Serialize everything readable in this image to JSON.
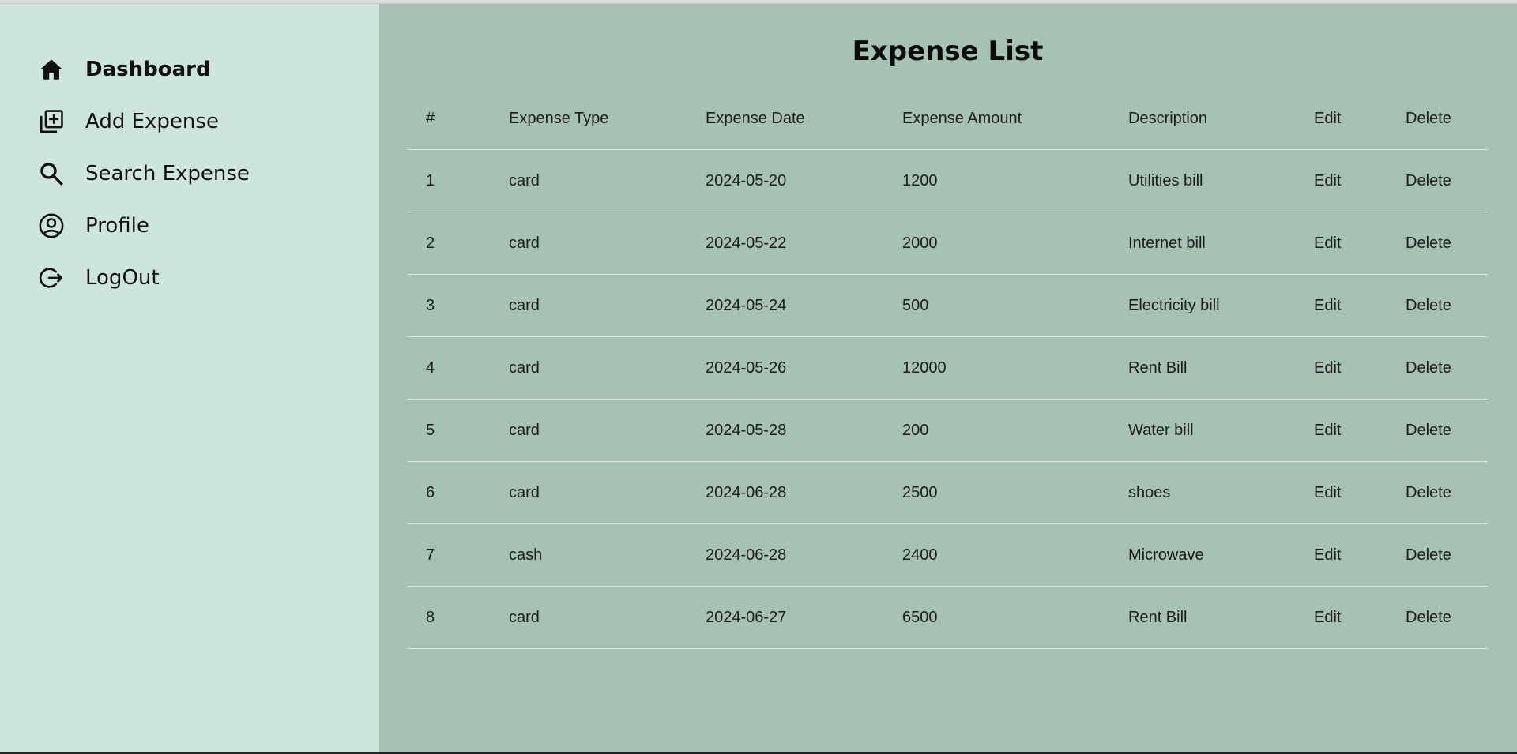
{
  "sidebar": {
    "items": [
      {
        "label": "Dashboard",
        "icon": "home-icon",
        "active": true
      },
      {
        "label": "Add Expense",
        "icon": "add-box-icon",
        "active": false
      },
      {
        "label": "Search Expense",
        "icon": "search-icon",
        "active": false
      },
      {
        "label": "Profile",
        "icon": "user-circle-icon",
        "active": false
      },
      {
        "label": "LogOut",
        "icon": "logout-icon",
        "active": false
      }
    ]
  },
  "main": {
    "title": "Expense List",
    "table": {
      "headers": [
        "#",
        "Expense Type",
        "Expense Date",
        "Expense Amount",
        "Description",
        "Edit",
        "Delete"
      ],
      "rows": [
        [
          "1",
          "card",
          "2024-05-20",
          "1200",
          "Utilities bill",
          "Edit",
          "Delete"
        ],
        [
          "2",
          "card",
          "2024-05-22",
          "2000",
          "Internet bill",
          "Edit",
          "Delete"
        ],
        [
          "3",
          "card",
          "2024-05-24",
          "500",
          "Electricity bill",
          "Edit",
          "Delete"
        ],
        [
          "4",
          "card",
          "2024-05-26",
          "12000",
          "Rent Bill",
          "Edit",
          "Delete"
        ],
        [
          "5",
          "card",
          "2024-05-28",
          "200",
          "Water bill",
          "Edit",
          "Delete"
        ],
        [
          "6",
          "card",
          "2024-06-28",
          "2500",
          "shoes",
          "Edit",
          "Delete"
        ],
        [
          "7",
          "cash",
          "2024-06-28",
          "2400",
          "Microwave",
          "Edit",
          "Delete"
        ],
        [
          "8",
          "card",
          "2024-06-27",
          "6500",
          "Rent Bill",
          "Edit",
          "Delete"
        ]
      ]
    }
  },
  "colors": {
    "sidebar_bg": "#cde4df",
    "main_bg": "#a5c2b4",
    "row_divider": "#dfe8e3"
  }
}
